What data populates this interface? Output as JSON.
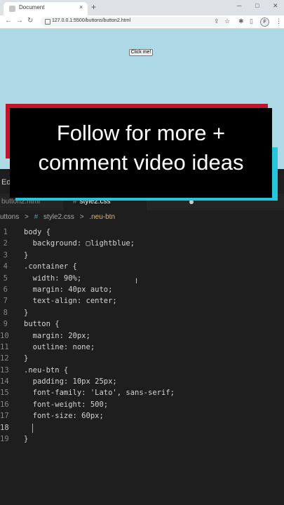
{
  "browser": {
    "tab_title": "Document",
    "tab_close": "×",
    "new_tab": "+",
    "url": "127.0.0.1:5500/buttons/button2.html",
    "profile_initial": "F",
    "icons": [
      "back-icon",
      "forward-icon",
      "reload-icon",
      "share-icon",
      "star-icon",
      "extensions-icon",
      "sidepanel-icon",
      "menu-icon"
    ]
  },
  "page": {
    "button_label": "Click me!",
    "background_color": "#add8e6"
  },
  "banner": {
    "line1": "Follow for more +",
    "line2": "comment video ideas",
    "colors": {
      "back_red": "#c0152f",
      "back_cyan": "#26c6da",
      "front": "#000000",
      "text": "#ffffff"
    }
  },
  "editor": {
    "menu_label": "Ed",
    "tabs": [
      {
        "label": "button2.html",
        "active": false
      },
      {
        "label": "style2.css",
        "active": true
      }
    ],
    "breadcrumb": [
      "uttons",
      ">",
      "#",
      "style2.css",
      ">",
      ".neu-btn"
    ],
    "current_line": 18,
    "lines": [
      {
        "n": "1",
        "text": "body {"
      },
      {
        "n": "2",
        "text": "  background: ▢lightblue;"
      },
      {
        "n": "3",
        "text": "}"
      },
      {
        "n": "4",
        "text": ".container {"
      },
      {
        "n": "5",
        "text": "  width: 90%;"
      },
      {
        "n": "6",
        "text": "  margin: 40px auto;"
      },
      {
        "n": "7",
        "text": "  text-align: center;"
      },
      {
        "n": "8",
        "text": "}"
      },
      {
        "n": "9",
        "text": "button {"
      },
      {
        "n": "10",
        "text": "  margin: 20px;"
      },
      {
        "n": "11",
        "text": "  outline: none;"
      },
      {
        "n": "12",
        "text": "}"
      },
      {
        "n": "13",
        "text": ".neu-btn {"
      },
      {
        "n": "14",
        "text": "  padding: 10px 25px;"
      },
      {
        "n": "15",
        "text": "  font-family: 'Lato', sans-serif;"
      },
      {
        "n": "16",
        "text": "  font-weight: 500;"
      },
      {
        "n": "17",
        "text": "  font-size: 60px;"
      },
      {
        "n": "18",
        "text": "  "
      },
      {
        "n": "19",
        "text": "}"
      }
    ]
  }
}
